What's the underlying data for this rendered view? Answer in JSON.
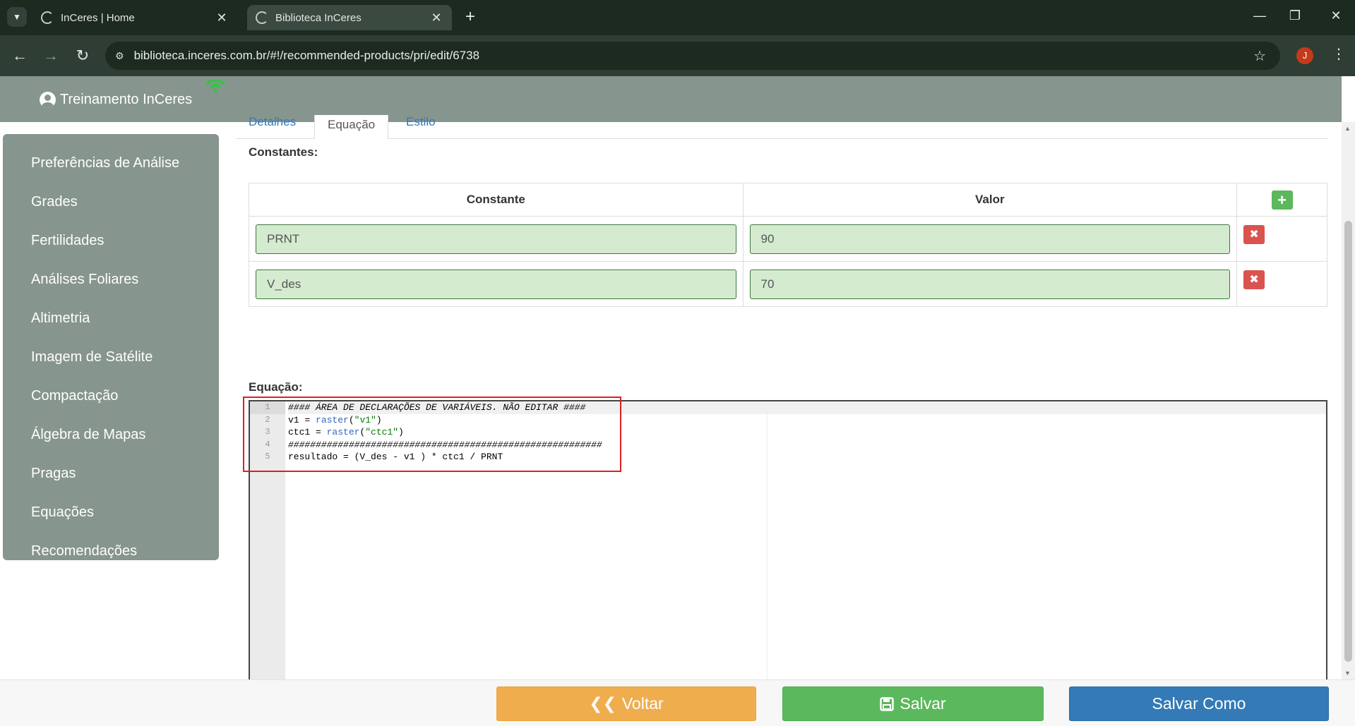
{
  "browser": {
    "tabs": [
      {
        "title": "InCeres | Home",
        "active": false
      },
      {
        "title": "Biblioteca InCeres",
        "active": true
      }
    ],
    "url": "biblioteca.inceres.com.br/#!/recommended-products/pri/edit/6738",
    "profile_initial": "J"
  },
  "header": {
    "user_name": "Treinamento InCeres"
  },
  "sidebar": {
    "items": [
      {
        "label": "Preferências de Análise"
      },
      {
        "label": "Grades"
      },
      {
        "label": "Fertilidades"
      },
      {
        "label": "Análises Foliares"
      },
      {
        "label": "Altimetria"
      },
      {
        "label": "Imagem de Satélite"
      },
      {
        "label": "Compactação"
      },
      {
        "label": "Álgebra de Mapas"
      },
      {
        "label": "Pragas"
      },
      {
        "label": "Equações"
      },
      {
        "label": "Recomendações"
      }
    ]
  },
  "main": {
    "tabs": [
      {
        "label": "Detalhes"
      },
      {
        "label": "Equação",
        "active": true
      },
      {
        "label": "Estilo"
      }
    ],
    "constants_label": "Constantes:",
    "table": {
      "headers": [
        "Constante",
        "Valor"
      ],
      "rows": [
        {
          "name": "PRNT",
          "value": "90"
        },
        {
          "name": "V_des",
          "value": "70"
        }
      ]
    },
    "equation_label": "Equação:",
    "editor": {
      "line_numbers": [
        "1",
        "2",
        "3",
        "4",
        "5"
      ],
      "lines": [
        "#### ÁREA DE DECLARAÇÕES DE VARIÁVEIS. NÃO EDITAR ####",
        "v1 = raster(\"v1\")",
        "ctc1 = raster(\"ctc1\")",
        "#########################################################",
        "resultado = (V_des - v1 ) * ctc1 / PRNT"
      ]
    }
  },
  "footer": {
    "back_label": "Voltar",
    "save_label": "Salvar",
    "save_as_label": "Salvar Como"
  },
  "colors": {
    "sidebar_bg": "#86958d",
    "input_bg": "#d4ebd0",
    "btn_back": "#f0ad4e",
    "btn_save": "#5cb85c",
    "btn_save_as": "#337ab7",
    "btn_delete": "#d9534f",
    "highlight": "#e02020"
  }
}
